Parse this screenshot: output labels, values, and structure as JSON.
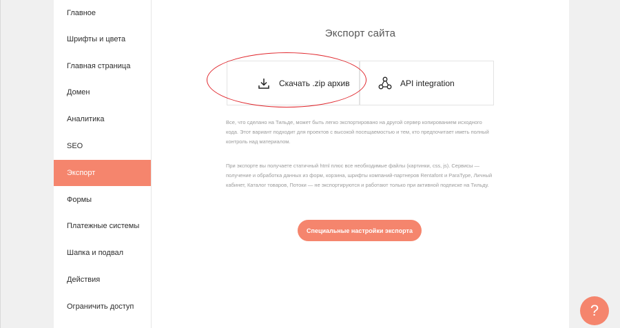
{
  "sidebar": {
    "items": [
      {
        "label": "Главное"
      },
      {
        "label": "Шрифты и цвета"
      },
      {
        "label": "Главная страница"
      },
      {
        "label": "Домен"
      },
      {
        "label": "Аналитика"
      },
      {
        "label": "SEO"
      },
      {
        "label": "Экспорт",
        "active": true
      },
      {
        "label": "Формы"
      },
      {
        "label": "Платежные системы"
      },
      {
        "label": "Шапка и подвал"
      },
      {
        "label": "Действия"
      },
      {
        "label": "Ограничить доступ"
      }
    ]
  },
  "main": {
    "title": "Экспорт сайта",
    "cards": {
      "zip": {
        "label": "Скачать .zip архив",
        "icon": "download-icon"
      },
      "api": {
        "label": "API integration",
        "icon": "network-icon"
      }
    },
    "paragraph1": "Все, что сделано на Тильде, может быть легко экспортировано на другой сервер копированием исходного кода. Этот вариант подходит для проектов с высокой посещаемостью и тем, кто предпочитает иметь полный контроль над материалом.",
    "paragraph2": "При экспорте вы получаете статичный html плюс все необходимые файлы (картинки, css, js). Сервисы — получение и обработка данных из форм, корзина, шрифты компаний-партнеров Rentafont и ParaType, Личный кабинет, Каталог товаров, Потоки — не экспортируются и работают только при активной подписке на Тильду.",
    "special_button": "Специальные настройки экспорта"
  },
  "help": {
    "label": "?"
  },
  "colors": {
    "accent": "#f5856d",
    "annotation": "#e0242a"
  }
}
